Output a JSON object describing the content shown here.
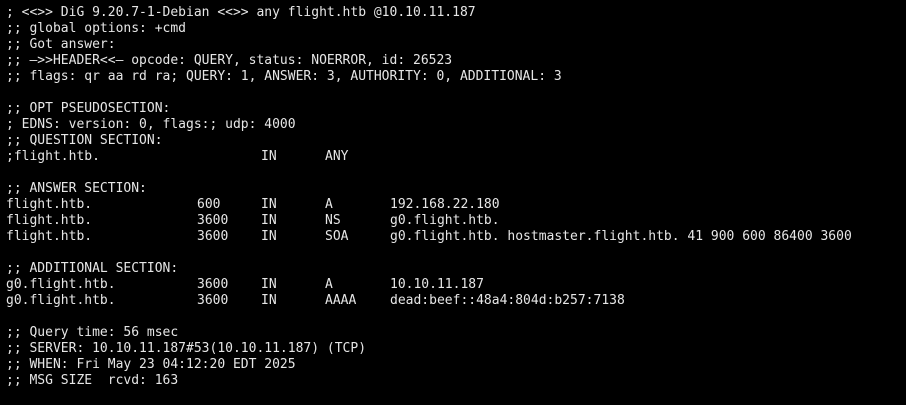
{
  "header": {
    "banner": "; <<>> DiG 9.20.7-1-Debian <<>> any flight.htb @10.10.11.187",
    "global_options": ";; global options: +cmd",
    "got_answer": ";; Got answer:",
    "header_line": ";; —>>HEADER<<— opcode: QUERY, status: NOERROR, id: 26523",
    "flags": ";; flags: qr aa rd ra; QUERY: 1, ANSWER: 3, AUTHORITY: 0, ADDITIONAL: 3"
  },
  "opt": {
    "title": ";; OPT PSEUDOSECTION:",
    "edns": "; EDNS: version: 0, flags:; udp: 4000"
  },
  "question": {
    "title": ";; QUESTION SECTION:",
    "name": ";flight.htb.",
    "class": "IN",
    "type": "ANY"
  },
  "answer": {
    "title": ";; ANSWER SECTION:",
    "rows": [
      {
        "name": "flight.htb.",
        "ttl": "600",
        "class": "IN",
        "type": "A",
        "data": "192.168.22.180"
      },
      {
        "name": "flight.htb.",
        "ttl": "3600",
        "class": "IN",
        "type": "NS",
        "data": "g0.flight.htb."
      },
      {
        "name": "flight.htb.",
        "ttl": "3600",
        "class": "IN",
        "type": "SOA",
        "data": "g0.flight.htb. hostmaster.flight.htb. 41 900 600 86400 3600"
      }
    ]
  },
  "additional": {
    "title": ";; ADDITIONAL SECTION:",
    "rows": [
      {
        "name": "g0.flight.htb.",
        "ttl": "3600",
        "class": "IN",
        "type": "A",
        "data": "10.10.11.187"
      },
      {
        "name": "g0.flight.htb.",
        "ttl": "3600",
        "class": "IN",
        "type": "AAAA",
        "data": "dead:beef::48a4:804d:b257:7138"
      }
    ]
  },
  "stats": {
    "query_time": ";; Query time: 56 msec",
    "server": ";; SERVER: 10.10.11.187#53(10.10.11.187) (TCP)",
    "when": ";; WHEN: Fri May 23 04:12:20 EDT 2025",
    "msg_size": ";; MSG SIZE  rcvd: 163"
  },
  "colors": {
    "background": "#000000",
    "foreground": "#e6e6e6"
  }
}
